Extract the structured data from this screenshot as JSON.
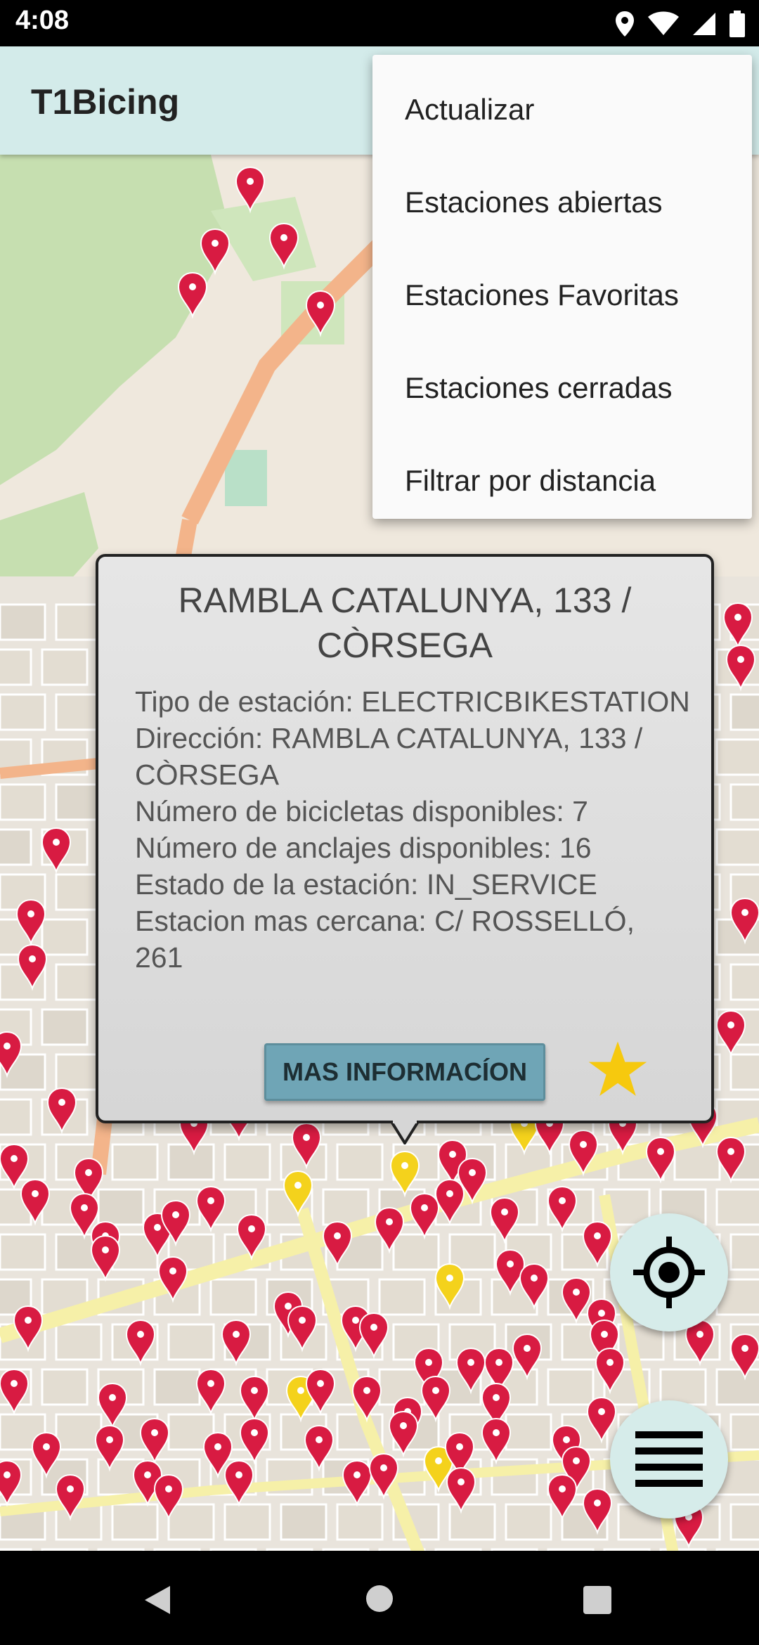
{
  "status_bar": {
    "time": "4:08",
    "icons": [
      "location-icon",
      "wifi-icon",
      "signal-icon",
      "battery-icon"
    ]
  },
  "app_bar": {
    "title": "T1Bicing"
  },
  "overflow_menu": {
    "items": [
      {
        "label": "Actualizar"
      },
      {
        "label": "Estaciones abiertas"
      },
      {
        "label": "Estaciones Favoritas"
      },
      {
        "label": "Estaciones cerradas"
      },
      {
        "label": "Filtrar por distancia"
      }
    ]
  },
  "station_popup": {
    "title": "RAMBLA CATALUNYA, 133 / CÒRSEGA",
    "details": [
      "Tipo de estación: ELECTRICBIKESTATION",
      "Dirección: RAMBLA CATALUNYA, 133 / CÒRSEGA",
      "Número de bicicletas disponibles: 7",
      "Número de anclajes disponibles: 16",
      "Estado de la estación: IN_SERVICE",
      "Estacion mas cercana: C/ ROSSELLÓ, 261"
    ],
    "more_info_label": "MAS INFORMACÍON",
    "favorite": true
  },
  "fabs": {
    "location": "my-location-icon",
    "list": "list-menu-icon"
  },
  "nav_bar": {
    "buttons": [
      "back-icon",
      "home-icon",
      "recents-icon"
    ]
  },
  "colors": {
    "app_bar": "#d3ebea",
    "marker_red": "#d81b42",
    "marker_yellow": "#f4d21c",
    "star": "#f6c90e",
    "button": "#6fa5b6",
    "fab": "#d6ecea"
  }
}
